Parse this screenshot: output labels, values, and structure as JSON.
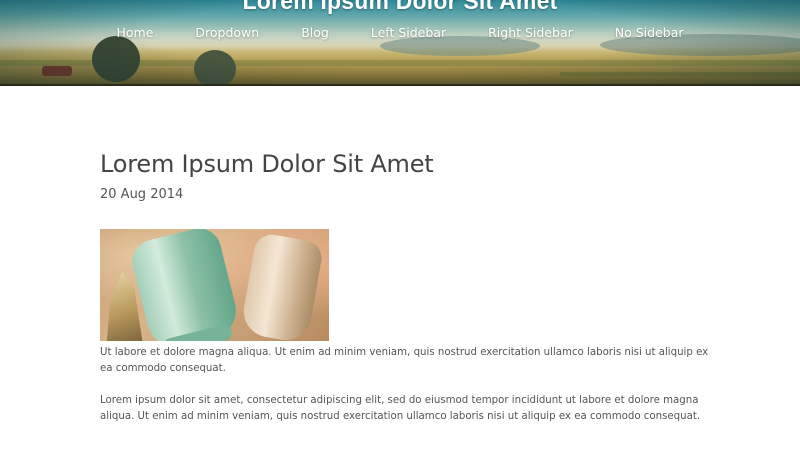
{
  "header": {
    "site_title": "Lorem Ipsum Dolor Sit Amet",
    "nav": [
      "Home",
      "Dropdown",
      "Blog",
      "Left Sidebar",
      "Right Sidebar",
      "No Sidebar"
    ]
  },
  "post": {
    "title": "Lorem Ipsum Dolor Sit Amet",
    "date": "20 Aug 2014",
    "paragraphs": [
      "Ut labore et dolore magna aliqua. Ut enim ad minim veniam, quis nostrud exercitation ullamco laboris nisi ut aliquip ex ea commodo consequat.",
      "Lorem ipsum dolor sit amet, consectetur adipiscing elit, sed do eiusmod tempor incididunt ut labore et dolore magna aliqua. Ut enim ad minim veniam, quis nostrud exercitation ullamco laboris nisi ut aliquip ex ea commodo consequat."
    ]
  },
  "colors": {
    "nav_text": "#ffffff",
    "body_text": "#444444",
    "background": "#ffffff"
  }
}
